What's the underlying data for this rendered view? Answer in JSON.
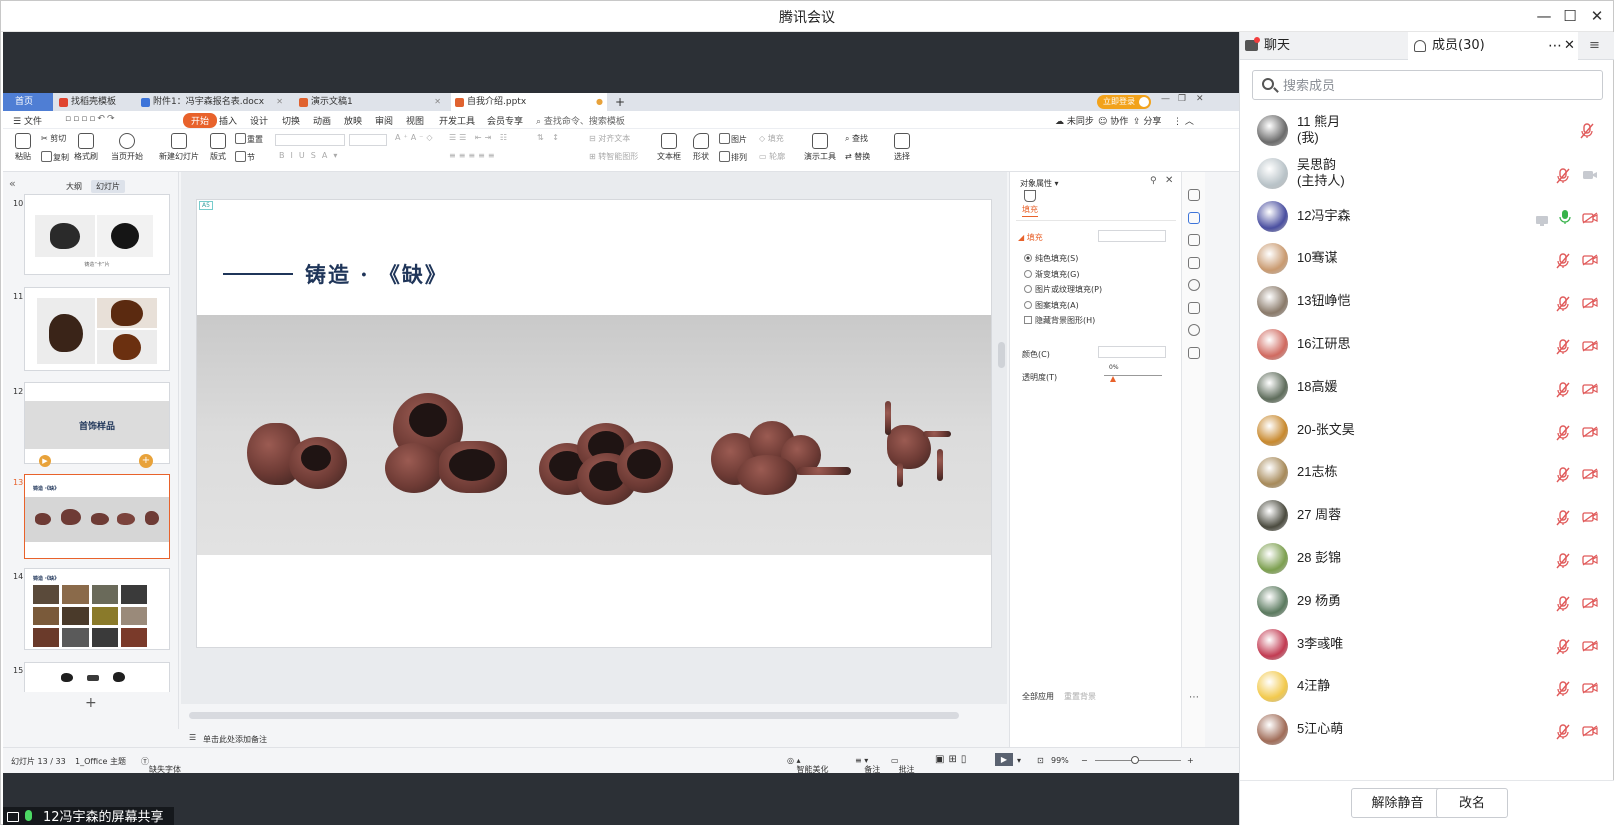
{
  "window": {
    "title": "腾讯会议",
    "minimize_glyph": "—",
    "maximize_glyph": "☐",
    "close_glyph": "✕"
  },
  "wps": {
    "tabs": [
      {
        "label": "首页"
      },
      {
        "label": "找稻壳模板"
      },
      {
        "label": "附件1：冯宇森报名表.docx"
      },
      {
        "label": "演示文稿1"
      },
      {
        "label": "自我介绍.pptx"
      }
    ],
    "tab_add": "+",
    "login_label": "立即登录",
    "menu": {
      "file": "文件",
      "items": [
        "开始",
        "插入",
        "设计",
        "切换",
        "动画",
        "放映",
        "审阅",
        "视图",
        "开发工具",
        "会员专享"
      ],
      "search": "查找命令、搜索模板",
      "right": [
        "未同步",
        "协作",
        "分享"
      ]
    },
    "ribbon": {
      "paste": "粘贴",
      "cut": "剪切",
      "copy": "复制",
      "format_painter": "格式刷",
      "from_current": "当页开始",
      "new_slide": "新建幻灯片",
      "layout": "版式",
      "section": "节",
      "reset": "重置",
      "align_text": "对齐文本",
      "smart_shape": "转智能图形",
      "textbox": "文本框",
      "shape": "形状",
      "arrange": "排列",
      "picture": "图片",
      "fill": "填充",
      "outline": "轮廓",
      "presenter_tools": "演示工具",
      "find": "查找",
      "replace": "替换",
      "select": "选择"
    },
    "thumbs": {
      "outline_tab": "大纲",
      "slides_tab": "幻灯片",
      "numbers": [
        "10",
        "11",
        "12",
        "13",
        "14",
        "15"
      ],
      "slide10_caption": "铸造“卡”片",
      "slide12_title": "首饰样品",
      "slide13_title": "铸造 ·《缺》",
      "slide14_title": "铸造 ·《缺》",
      "add": "+"
    },
    "slide": {
      "badge": "A5",
      "title": "铸造 · 《缺》"
    },
    "notes_placeholder": "单击此处添加备注",
    "props": {
      "header": "对象属性",
      "tab_fill": "填充",
      "section_fill": "填充",
      "options": [
        "纯色填充(S)",
        "渐变填充(G)",
        "图片或纹理填充(P)",
        "图案填充(A)"
      ],
      "hide_bg": "隐藏背景图形(H)",
      "color_label": "颜色(C)",
      "transparency_label": "透明度(T)",
      "transparency_value": "0%",
      "apply_all": "全部应用",
      "reset_bg": "重置背景"
    },
    "status": {
      "slide_count": "幻灯片 13 / 33",
      "theme": "1_Office 主题",
      "missing_font": "缺失字体",
      "beautify": "智能美化",
      "notes": "备注",
      "comments": "批注",
      "zoom": "99%"
    }
  },
  "share_badge": "12冯宇森的屏幕共享",
  "panel": {
    "tab_chat": "聊天",
    "tab_members": "成员(30)",
    "search_placeholder": "搜索成员",
    "members": [
      {
        "name": "11 熊月",
        "sub": "(我)",
        "color": "#6b6b6b"
      },
      {
        "name": "吴思韵",
        "sub": "(主持人)",
        "color": "#b9c3c8"
      },
      {
        "name": "12冯宇森",
        "sub": "",
        "color": "#4a4fa0"
      },
      {
        "name": "10骞谋",
        "sub": "",
        "color": "#c99a70"
      },
      {
        "name": "13钮峥恺",
        "sub": "",
        "color": "#8a7a6a"
      },
      {
        "name": "16江研思",
        "sub": "",
        "color": "#d06a60"
      },
      {
        "name": "18高媛",
        "sub": "",
        "color": "#5f6d5c"
      },
      {
        "name": "20-张文昊",
        "sub": "",
        "color": "#c8892e"
      },
      {
        "name": "21志栋",
        "sub": "",
        "color": "#a78a5a"
      },
      {
        "name": "27 周蓉",
        "sub": "",
        "color": "#4b4b3f"
      },
      {
        "name": "28 彭锦",
        "sub": "",
        "color": "#7c9f4f"
      },
      {
        "name": "29 杨勇",
        "sub": "",
        "color": "#5b7a5f"
      },
      {
        "name": "3李彧唯",
        "sub": "",
        "color": "#c23b52"
      },
      {
        "name": "4汪静",
        "sub": "",
        "color": "#f2c94c"
      },
      {
        "name": "5江心萌",
        "sub": "",
        "color": "#a06c58"
      }
    ],
    "unmute_all": "解除静音",
    "rename": "改名"
  },
  "colors": {
    "accent": "#e8622b",
    "slide_title": "#1f3559",
    "mic_off": "#e05a5a",
    "mic_on": "#37b34a"
  }
}
